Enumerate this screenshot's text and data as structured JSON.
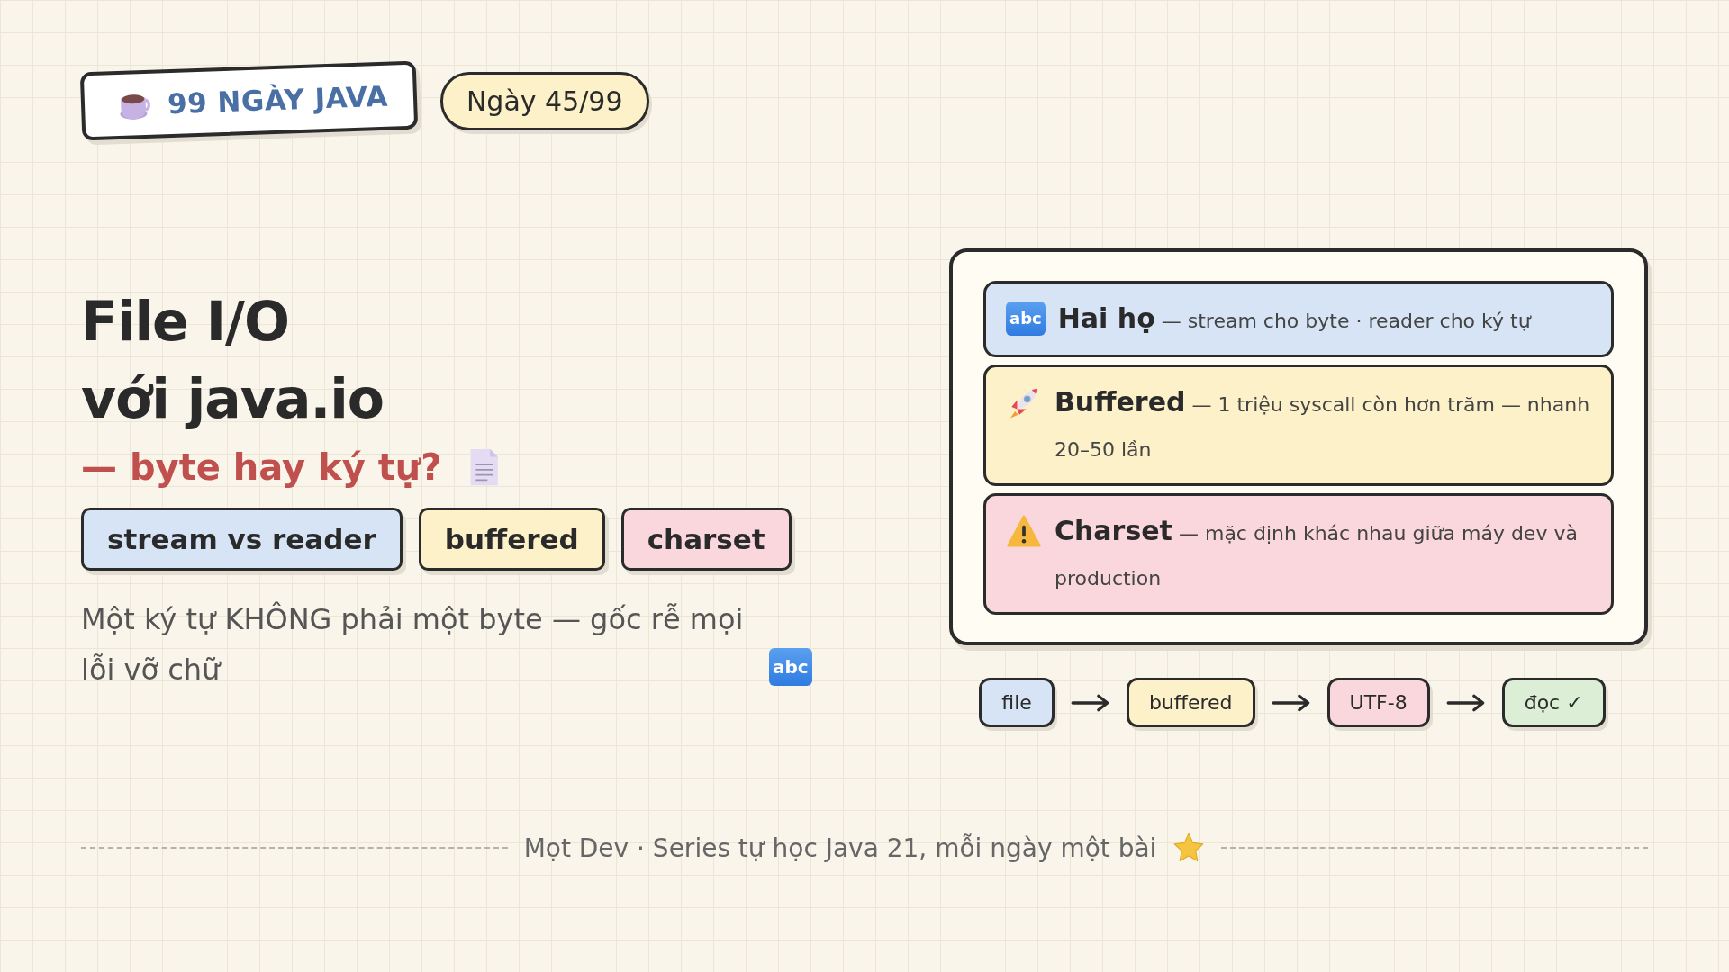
{
  "header": {
    "badge": {
      "text": "99 NGÀY JAVA"
    },
    "day_pill": "Ngày 45/99"
  },
  "title": {
    "lines": [
      "File I/O",
      "với java.io"
    ],
    "subtitle": "— byte hay ký tự?"
  },
  "tags": [
    {
      "label": "stream vs reader",
      "color": "#d6e4f5"
    },
    {
      "label": "buffered",
      "color": "#fcf1c8"
    },
    {
      "label": "charset",
      "color": "#f9d7dd"
    }
  ],
  "lead": {
    "text": "Một ký tự KHÔNG phải một byte — gốc rễ mọi lỗi vỡ chữ",
    "icon_text": "abc"
  },
  "cards": [
    {
      "icon_text": "abc",
      "title": "Hai họ",
      "text": "— stream cho byte · reader cho ký tự",
      "color": "#d6e4f5"
    },
    {
      "title": "Buffered",
      "text": "— 1 triệu syscall còn hơn trăm — nhanh 20–50 lần",
      "color": "#fcf1c8"
    },
    {
      "title": "Charset",
      "text": "— mặc định khác nhau giữa máy dev và production",
      "color": "#f9d7dd"
    }
  ],
  "flow": [
    {
      "label": "file",
      "color": "#d6e4f5"
    },
    {
      "label": "buffered",
      "color": "#fcf1c8"
    },
    {
      "label": "UTF-8",
      "color": "#f9d7dd"
    },
    {
      "label": "đọc ✓",
      "color": "#dcefd6"
    }
  ],
  "footer": {
    "text": "Mọt Dev · Series tự học Java 21, mỗi ngày một bài"
  }
}
